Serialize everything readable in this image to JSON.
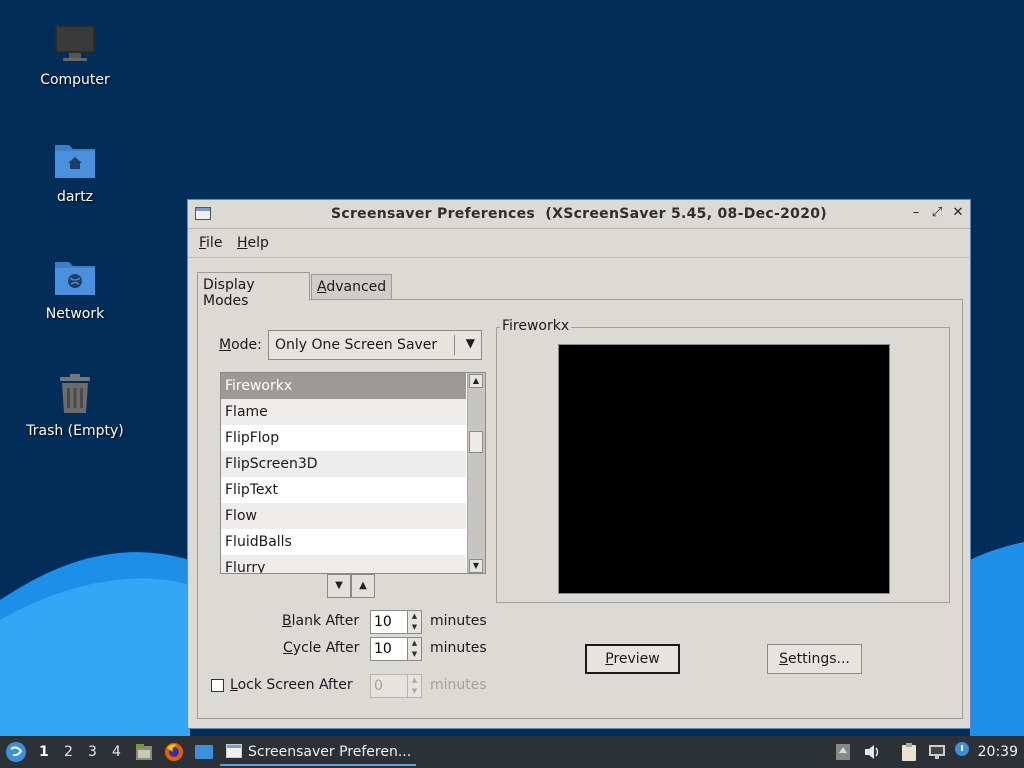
{
  "desktop": {
    "icons": [
      {
        "label": "Computer",
        "icon": "computer-icon"
      },
      {
        "label": "dartz",
        "icon": "home-folder-icon"
      },
      {
        "label": "Network",
        "icon": "network-folder-icon"
      },
      {
        "label": "Trash (Empty)",
        "icon": "trash-icon"
      }
    ]
  },
  "window": {
    "title": "Screensaver Preferences  (XScreenSaver 5.45, 08-Dec-2020)",
    "controls": {
      "minimize": "–",
      "maximize": "⤢",
      "close": "✕"
    },
    "menu": {
      "file": "File",
      "help": "Help"
    },
    "tabs": [
      {
        "label": "Display Modes",
        "active": true
      },
      {
        "label": "Advanced",
        "active": false
      }
    ],
    "mode": {
      "label": "Mode:",
      "value": "Only One Screen Saver"
    },
    "savers": [
      "Fireworkx",
      "Flame",
      "FlipFlop",
      "FlipScreen3D",
      "FlipText",
      "Flow",
      "FluidBalls",
      "Flurry"
    ],
    "selected_saver": "Fireworkx",
    "blank_after": {
      "label": "Blank After",
      "value": "10",
      "unit": "minutes"
    },
    "cycle_after": {
      "label": "Cycle After",
      "value": "10",
      "unit": "minutes"
    },
    "lock_screen": {
      "label": "Lock Screen After",
      "value": "0",
      "unit": "minutes",
      "checked": false
    },
    "preview_frame_title": "Fireworkx",
    "buttons": {
      "preview": "Preview",
      "settings": "Settings..."
    }
  },
  "taskbar": {
    "workspaces": [
      "1",
      "2",
      "3",
      "4"
    ],
    "active_workspace": "1",
    "task_label": "Screensaver Preferen...",
    "clock": "20:39"
  },
  "colors": {
    "desktop_bg": "#032d59",
    "wave": "#1e8fe8",
    "taskbar": "#2c3138",
    "window_bg": "#dcdad5",
    "selection": "#9c9a96"
  }
}
